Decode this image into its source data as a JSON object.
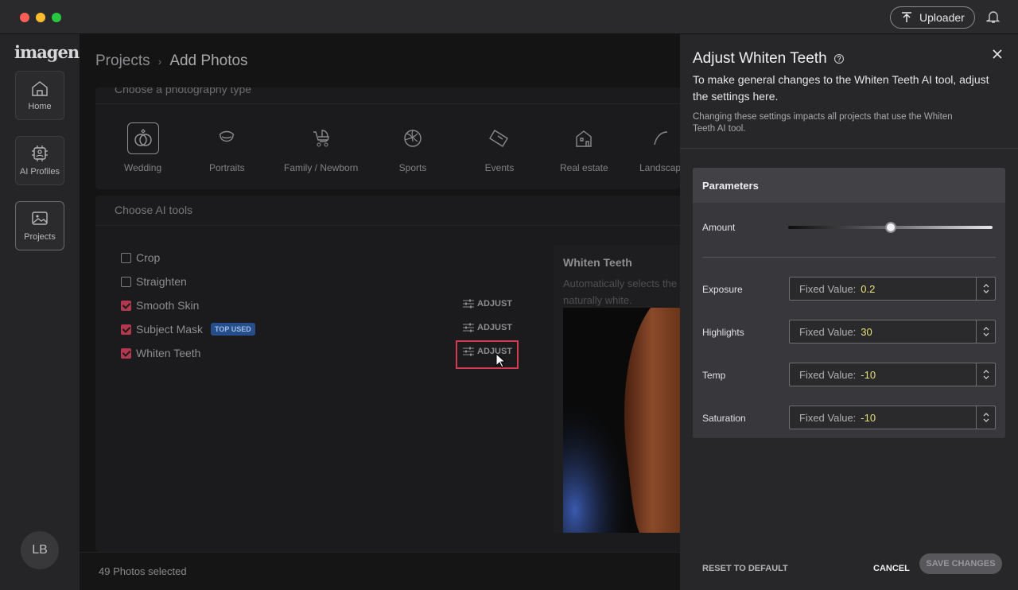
{
  "topbar": {
    "uploader_label": "Uploader"
  },
  "sidebar": {
    "logo": "imagen",
    "items": [
      {
        "label": "Home",
        "icon": "home-icon"
      },
      {
        "label": "AI Profiles",
        "icon": "ai-profile-icon"
      },
      {
        "label": "Projects",
        "icon": "projects-icon"
      }
    ],
    "avatar_initials": "LB"
  },
  "breadcrumb": {
    "parent": "Projects",
    "current": "Add Photos"
  },
  "photo_type": {
    "header": "Choose a photography type",
    "types": [
      "Wedding",
      "Portraits",
      "Family / Newborn",
      "Sports",
      "Events",
      "Real estate",
      "Landscape"
    ]
  },
  "ai_tools": {
    "header": "Choose AI tools",
    "tools": [
      {
        "label": "Crop",
        "checked": false
      },
      {
        "label": "Straighten",
        "checked": false
      },
      {
        "label": "Smooth Skin",
        "checked": true,
        "adjust": "ADJUST"
      },
      {
        "label": "Subject Mask",
        "checked": true,
        "adjust": "ADJUST",
        "badge": "TOP USED"
      },
      {
        "label": "Whiten Teeth",
        "checked": true,
        "adjust": "ADJUST"
      }
    ],
    "preview_title": "Whiten Teeth",
    "preview_desc_1": "Automatically selects the",
    "preview_desc_2": "naturally white."
  },
  "status": {
    "selected": "49 Photos selected"
  },
  "panel": {
    "title": "Adjust Whiten Teeth",
    "subtitle": "To make general changes to the Whiten Teeth AI tool, adjust the settings here.",
    "note": "Changing these settings impacts all projects that use the Whiten Teeth AI tool.",
    "params_header": "Parameters",
    "amount_label": "Amount",
    "amount_level": 0.5,
    "fields": [
      {
        "label": "Exposure",
        "prefix": "Fixed Value:",
        "value": "0.2"
      },
      {
        "label": "Highlights",
        "prefix": "Fixed Value:",
        "value": "30"
      },
      {
        "label": "Temp",
        "prefix": "Fixed Value:",
        "value": "-10"
      },
      {
        "label": "Saturation",
        "prefix": "Fixed Value:",
        "value": "-10"
      }
    ],
    "reset_label": "RESET TO DEFAULT",
    "cancel_label": "CANCEL",
    "save_label": "SAVE CHANGES"
  }
}
